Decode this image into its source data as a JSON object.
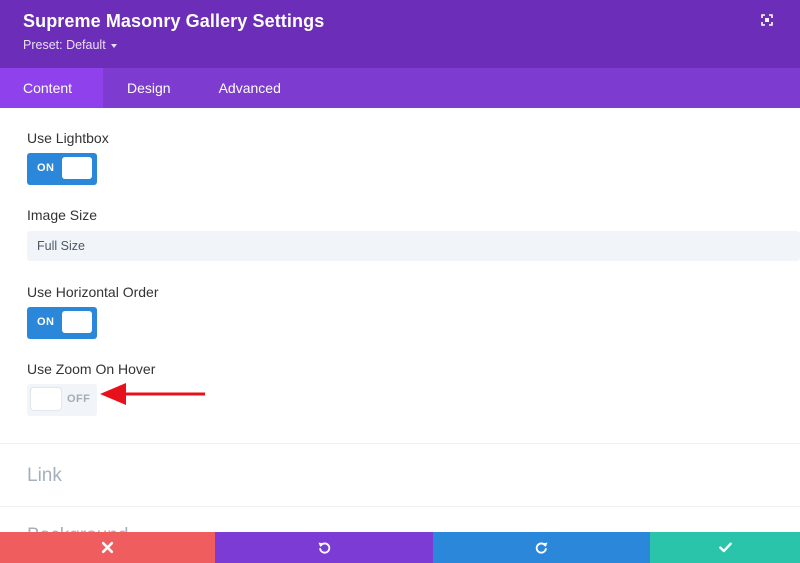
{
  "header": {
    "title": "Supreme Masonry Gallery Settings",
    "preset_label": "Preset: Default",
    "expand_icon": "expand-icon"
  },
  "tabs": [
    {
      "label": "Content",
      "active": true
    },
    {
      "label": "Design",
      "active": false
    },
    {
      "label": "Advanced",
      "active": false
    }
  ],
  "fields": {
    "use_lightbox": {
      "label": "Use Lightbox",
      "state": "ON"
    },
    "image_size": {
      "label": "Image Size",
      "value": "Full Size"
    },
    "use_horizontal_order": {
      "label": "Use Horizontal Order",
      "state": "ON"
    },
    "use_zoom_on_hover": {
      "label": "Use Zoom On Hover",
      "state": "OFF"
    }
  },
  "sections": {
    "link": "Link",
    "background_partial": "Background"
  },
  "footer": {
    "buttons": [
      {
        "icon": "close-icon",
        "color": "#ef5d5e"
      },
      {
        "icon": "undo-icon",
        "color": "#7c3bd4"
      },
      {
        "icon": "redo-icon",
        "color": "#2b87da"
      },
      {
        "icon": "check-icon",
        "color": "#29c4a9"
      }
    ]
  },
  "colors": {
    "header_bg": "#6c2eb9",
    "tabs_bg": "#7d3bcf",
    "active_tab_bg": "#8f42ec",
    "toggle_on": "#2b87da",
    "arrow": "#e8101a"
  }
}
